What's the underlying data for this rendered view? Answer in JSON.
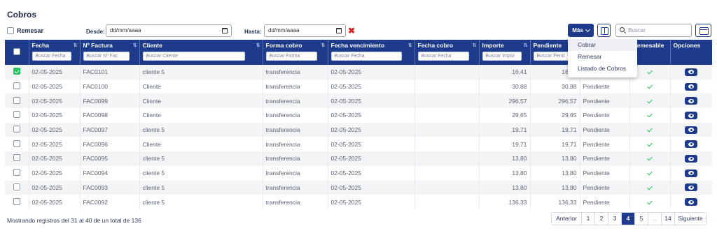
{
  "page": {
    "title": "Cobros"
  },
  "toolbar": {
    "remesar_label": "Remesar",
    "desde_label": "Desde:",
    "desde_value": "dd/mm/aaaa",
    "hasta_label": "Hasta:",
    "hasta_value": "dd/mm/aaaa",
    "clear_symbol": "✖",
    "mas_label": "Más",
    "search_placeholder": "Buscar"
  },
  "dropdown": {
    "items": [
      "Cobrar",
      "Remesar",
      "Listado de Cobros"
    ]
  },
  "table": {
    "headers": [
      {
        "label": "Fecha",
        "filter": "Buscar Fecha"
      },
      {
        "label": "Nº Factura",
        "filter": "Buscar Nº Fac"
      },
      {
        "label": "Cliente",
        "filter": "Buscar Cliente"
      },
      {
        "label": "Forma cobro",
        "filter": "Buscar Forma"
      },
      {
        "label": "Fecha vencimiento",
        "filter": "Buscar Fecha"
      },
      {
        "label": "Fecha cobro",
        "filter": "Buscar Fecha"
      },
      {
        "label": "Importe",
        "filter": "Buscar Impor"
      },
      {
        "label": "Pendiente",
        "filter": "Buscar Pend"
      },
      {
        "label": "",
        "filter": ""
      },
      {
        "label": "Remesable",
        "filter": ""
      },
      {
        "label": "Opciones",
        "filter": ""
      }
    ],
    "rows": [
      {
        "checked": true,
        "fecha": "02-05-2025",
        "factura": "FAC0101",
        "cliente": "cliente 5",
        "forma": "transferencia",
        "vencimiento": "02-05-2025",
        "cobro": "",
        "importe": "16,41",
        "pendiente": "16,41",
        "estado": "Pendiente"
      },
      {
        "checked": false,
        "fecha": "02-05-2025",
        "factura": "FAC0100",
        "cliente": "Cliente",
        "forma": "transferencia",
        "vencimiento": "02-05-2025",
        "cobro": "",
        "importe": "30,88",
        "pendiente": "30,88",
        "estado": "Pendiente"
      },
      {
        "checked": false,
        "fecha": "02-05-2025",
        "factura": "FAC0099",
        "cliente": "Cliente",
        "forma": "transferencia",
        "vencimiento": "02-05-2025",
        "cobro": "",
        "importe": "296,57",
        "pendiente": "296,57",
        "estado": "Pendiente"
      },
      {
        "checked": false,
        "fecha": "02-05-2025",
        "factura": "FAC0098",
        "cliente": "Cliente",
        "forma": "transferencia",
        "vencimiento": "02-05-2025",
        "cobro": "",
        "importe": "29,65",
        "pendiente": "29,65",
        "estado": "Pendiente"
      },
      {
        "checked": false,
        "fecha": "02-05-2025",
        "factura": "FAC0097",
        "cliente": "cliente 5",
        "forma": "transferencia",
        "vencimiento": "02-05-2025",
        "cobro": "",
        "importe": "19,71",
        "pendiente": "19,71",
        "estado": "Pendiente"
      },
      {
        "checked": false,
        "fecha": "02-05-2025",
        "factura": "FAC0096",
        "cliente": "Cliente",
        "forma": "transferencia",
        "vencimiento": "02-05-2025",
        "cobro": "",
        "importe": "19,71",
        "pendiente": "19,71",
        "estado": "Pendiente"
      },
      {
        "checked": false,
        "fecha": "02-05-2025",
        "factura": "FAC0095",
        "cliente": "cliente 5",
        "forma": "transferencia",
        "vencimiento": "02-05-2025",
        "cobro": "",
        "importe": "13,80",
        "pendiente": "13,80",
        "estado": "Pendiente"
      },
      {
        "checked": false,
        "fecha": "02-05-2025",
        "factura": "FAC0094",
        "cliente": "cliente 5",
        "forma": "transferencia",
        "vencimiento": "02-05-2025",
        "cobro": "",
        "importe": "13,80",
        "pendiente": "13,80",
        "estado": "Pendiente"
      },
      {
        "checked": false,
        "fecha": "02-05-2025",
        "factura": "FAC0093",
        "cliente": "cliente 5",
        "forma": "transferencia",
        "vencimiento": "02-05-2025",
        "cobro": "",
        "importe": "13,80",
        "pendiente": "13,80",
        "estado": "Pendiente"
      },
      {
        "checked": false,
        "fecha": "02-05-2025",
        "factura": "FAC0092",
        "cliente": "cliente 5",
        "forma": "transferencia",
        "vencimiento": "02-05-2025",
        "cobro": "",
        "importe": "136,33",
        "pendiente": "136,33",
        "estado": "Pendiente"
      }
    ]
  },
  "footer": {
    "info": "Mostrando registros del 31 al 40 de un total de 136",
    "pager": [
      {
        "label": "Anterior",
        "active": false
      },
      {
        "label": "1",
        "active": false
      },
      {
        "label": "2",
        "active": false
      },
      {
        "label": "3",
        "active": false
      },
      {
        "label": "4",
        "active": true
      },
      {
        "label": "5",
        "active": false
      },
      {
        "label": "...",
        "active": false
      },
      {
        "label": "14",
        "active": false
      },
      {
        "label": "Siguiente",
        "active": false
      }
    ]
  },
  "colors": {
    "primary": "#1e3a8a",
    "success": "#22c55e",
    "danger": "#dc2626"
  }
}
